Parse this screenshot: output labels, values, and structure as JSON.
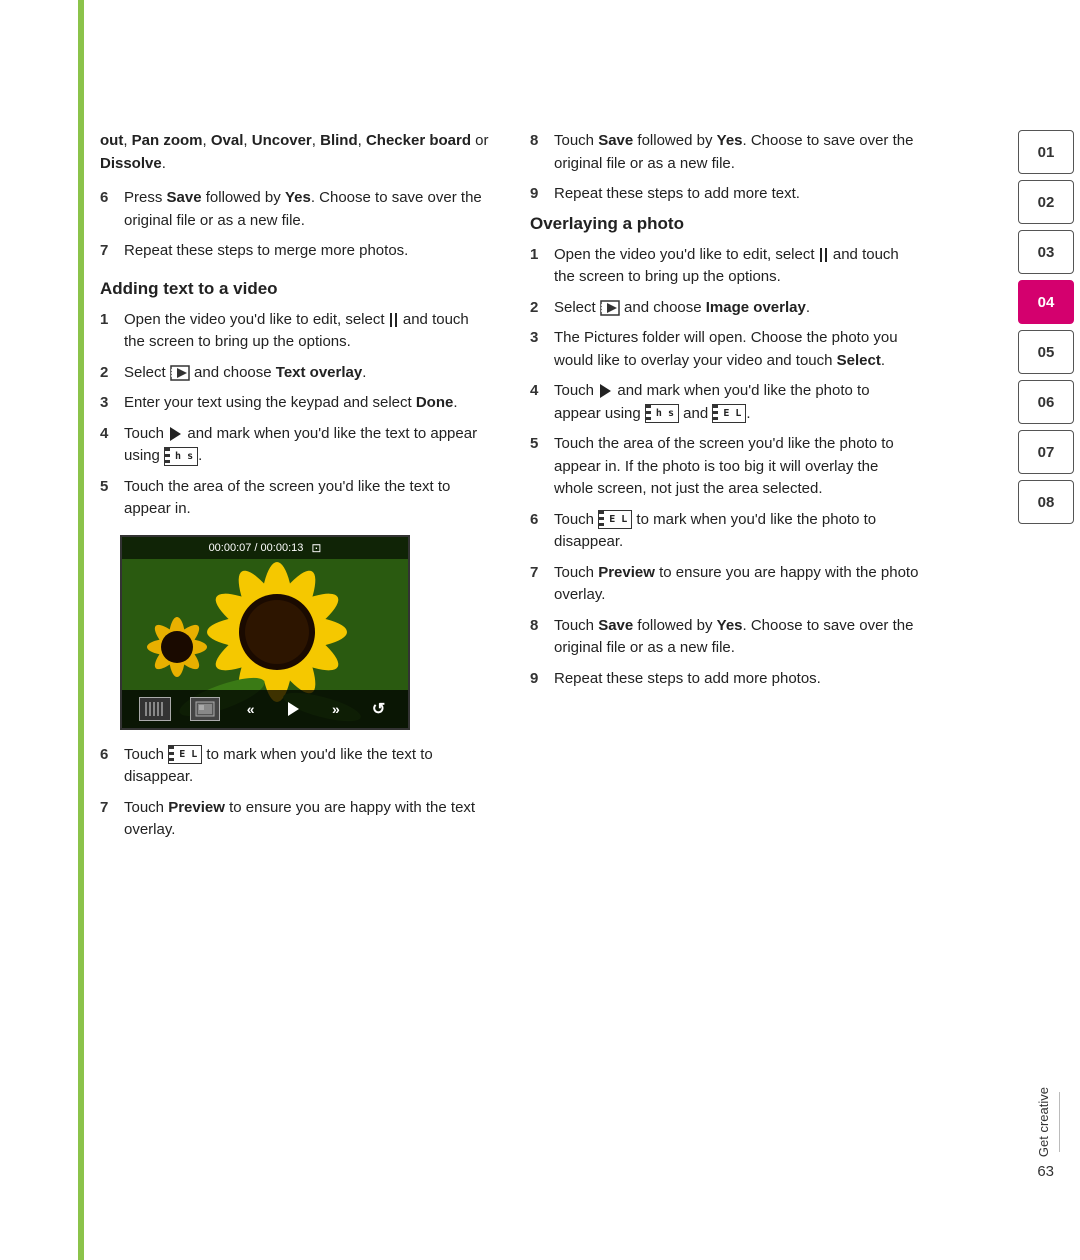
{
  "page": {
    "number": "63",
    "bottom_label": "Get creative"
  },
  "left_line_color": "#8BC34A",
  "sidebar": {
    "tabs": [
      {
        "label": "01",
        "active": false
      },
      {
        "label": "02",
        "active": false
      },
      {
        "label": "03",
        "active": false
      },
      {
        "label": "04",
        "active": true
      },
      {
        "label": "05",
        "active": false
      },
      {
        "label": "06",
        "active": false
      },
      {
        "label": "07",
        "active": false
      },
      {
        "label": "08",
        "active": false
      }
    ]
  },
  "intro": {
    "text": "out, Pan zoom, Oval, Uncover, Blind, Checker board or Dissolve."
  },
  "left_column": {
    "pre_steps": [
      {
        "number": "6",
        "text": "Press Save followed by Yes. Choose to save over the original file or as a new file."
      },
      {
        "number": "7",
        "text": "Repeat these steps to merge more photos."
      }
    ],
    "section_heading": "Adding text to a video",
    "steps": [
      {
        "number": "1",
        "text": "Open the video you'd like to edit, select and touch the screen to bring up the options."
      },
      {
        "number": "2",
        "text": "Select and choose Text overlay."
      },
      {
        "number": "3",
        "text": "Enter your text using the keypad and select Done."
      },
      {
        "number": "4",
        "text": "Touch and mark when you'd like the text to appear using."
      },
      {
        "number": "5",
        "text": "Touch the area of the screen you'd like the text to appear in."
      }
    ],
    "post_steps": [
      {
        "number": "6",
        "text": "Touch to mark when you'd like the text to disappear."
      },
      {
        "number": "7",
        "text": "Touch Preview to ensure you are happy with the text overlay."
      }
    ]
  },
  "right_column": {
    "pre_steps": [
      {
        "number": "8",
        "text": "Touch Save followed by Yes. Choose to save over the original file or as a new file."
      },
      {
        "number": "9",
        "text": "Repeat these steps to add more text."
      }
    ],
    "section_heading": "Overlaying a photo",
    "steps": [
      {
        "number": "1",
        "text": "Open the video you'd like to edit, select and touch the screen to bring up the options."
      },
      {
        "number": "2",
        "text": "Select and choose Image overlay."
      },
      {
        "number": "3",
        "text": "The Pictures folder will open. Choose the photo you would like to overlay your video and touch Select."
      },
      {
        "number": "4",
        "text": "Touch and mark when you'd like the photo to appear using and."
      },
      {
        "number": "5",
        "text": "Touch the area of the screen you'd like the photo to appear in. If the photo is too big it will overlay the whole screen, not just the area selected."
      },
      {
        "number": "6",
        "text": "Touch to mark when you'd like the photo to disappear."
      },
      {
        "number": "7",
        "text": "Touch Preview to ensure you are happy with the photo overlay."
      },
      {
        "number": "8",
        "text": "Touch Save followed by Yes. Choose to save over the original file or as a new file."
      },
      {
        "number": "9",
        "text": "Repeat these steps to add more photos."
      }
    ]
  },
  "video_ui": {
    "timecode": "00:00:07 / 00:00:13"
  }
}
